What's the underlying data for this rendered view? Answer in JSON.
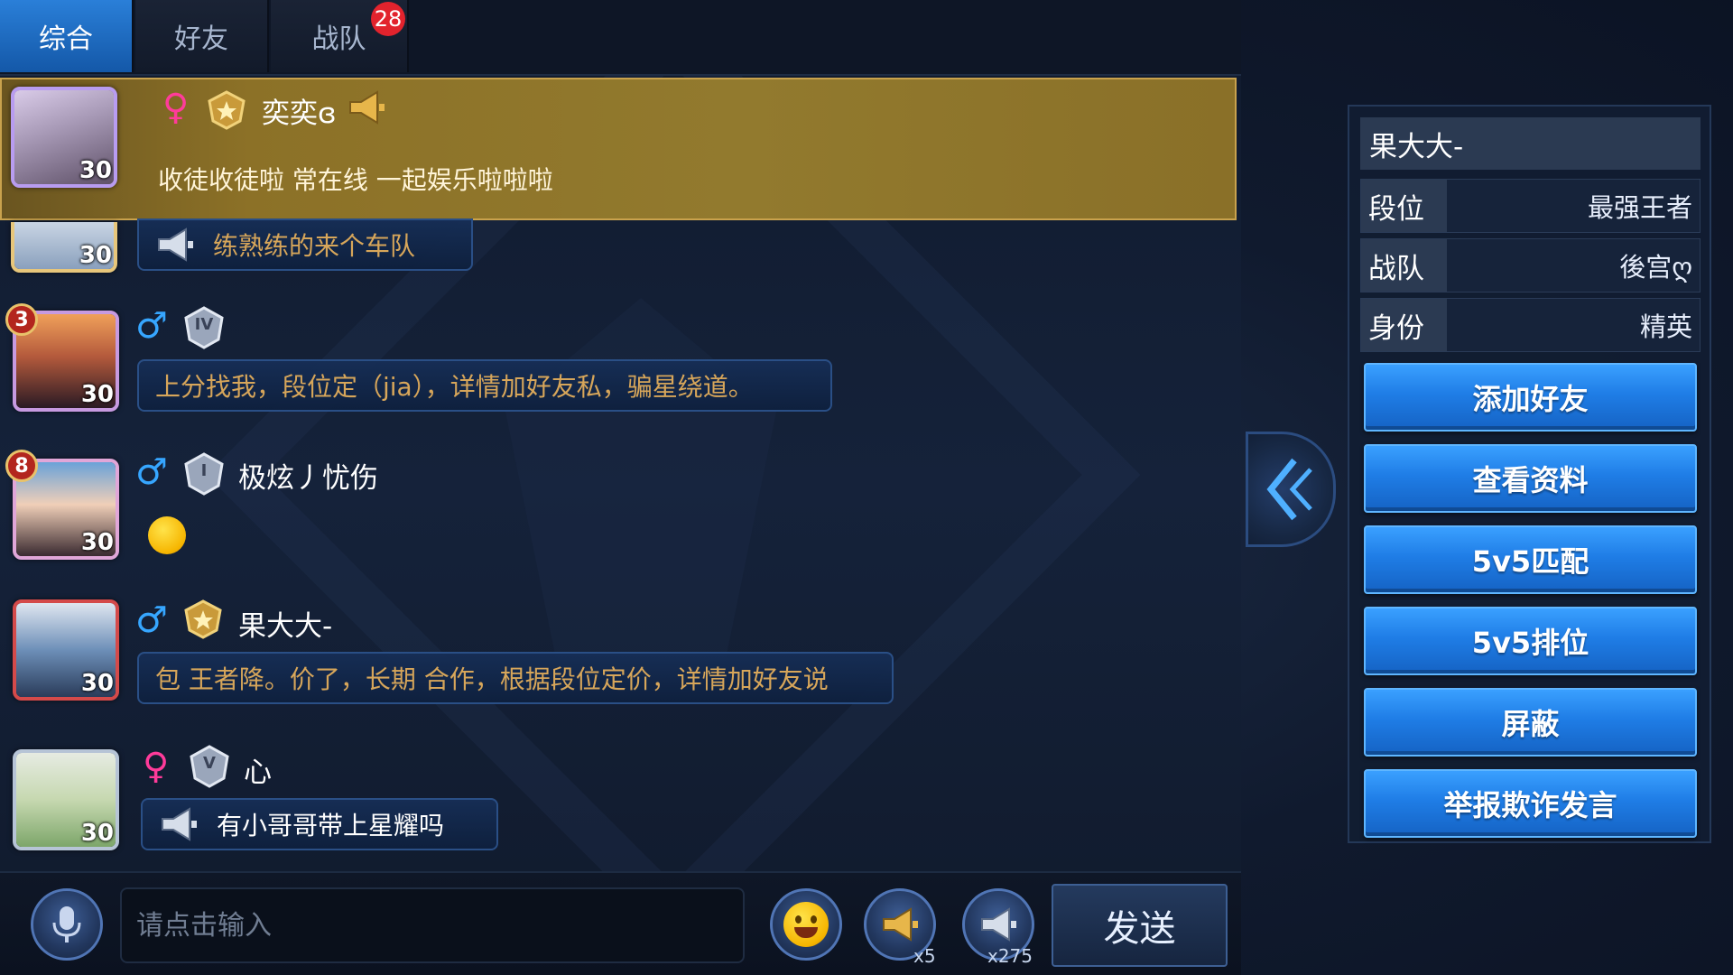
{
  "tabs": [
    {
      "label": "综合",
      "active": true
    },
    {
      "label": "好友",
      "active": false
    },
    {
      "label": "战队",
      "active": false,
      "badge": "28"
    }
  ],
  "messages": [
    {
      "level": "30",
      "gender": "♀",
      "name": "奕奕ɞ",
      "text": "收徒收徒啦 常在线 一起娱乐啦啦啦",
      "highlighted": true
    },
    {
      "level": "30",
      "text": "练熟练的来个车队",
      "horn": true
    },
    {
      "level": "30",
      "rank": "3",
      "gender": "♂",
      "tier": "IV",
      "text": "上分找我，段位定（jia），详情加好友私，骗星绕道。"
    },
    {
      "level": "30",
      "rank": "8",
      "gender": "♂",
      "tier": "I",
      "name": "极炫丿忧伤",
      "emoji": "emoji-face"
    },
    {
      "level": "30",
      "gender": "♂",
      "name": "果大大-",
      "text": "包 王者降。价了，长期 合作，根据段位定价，详情加好友说"
    },
    {
      "level": "30",
      "gender": "♀",
      "tier": "V",
      "name": "心",
      "text": "有小哥哥带上星耀吗",
      "horn": true
    }
  ],
  "input": {
    "placeholder": "请点击输入",
    "send_label": "发送",
    "small_horn_count": "x5",
    "big_horn_count": "x275"
  },
  "player_card": {
    "name": "果大大-",
    "rows": [
      {
        "label": "段位",
        "value": "最强王者"
      },
      {
        "label": "战队",
        "value": "後宫ღ"
      },
      {
        "label": "身份",
        "value": "精英"
      }
    ],
    "buttons": [
      "添加好友",
      "查看资料",
      "5v5匹配",
      "5v5排位",
      "屏蔽",
      "举报欺诈发言"
    ]
  },
  "colors": {
    "tab_active": "#1f6fc4",
    "highlight_gold": "#8c7127",
    "bubble_text_gold": "#d7a65a",
    "male": "#36a6ff",
    "female": "#ff3b9a",
    "action_button": "#1f7de6",
    "badge_red": "#e2232d"
  }
}
